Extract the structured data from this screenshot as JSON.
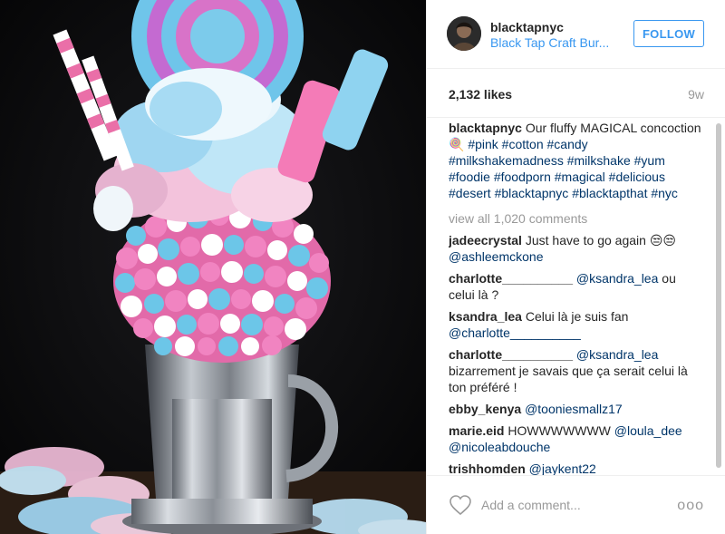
{
  "post": {
    "username": "blacktapnyc",
    "location": "Black Tap Craft Bur...",
    "follow_label": "FOLLOW",
    "likes": "2,132 likes",
    "age": "9w"
  },
  "caption": {
    "username": "blacktapnyc",
    "text": "Our fluffy MAGICAL concoction🍭",
    "hashtags": "#pink #cotton #candy #milkshakemadness #milkshake #yum #foodie #foodporn #magical #delicious #desert #blacktapnyc #blacktapthat #nyc"
  },
  "view_all_label": "view all 1,020 comments",
  "comments": [
    {
      "user": "jadeecrystal",
      "text": "Just have to go again 😒😒",
      "tag": "@ashleemckone"
    },
    {
      "user": "charlotte__________",
      "tag": "@ksandra_lea",
      "text": "ou celui là ?"
    },
    {
      "user": "ksandra_lea",
      "text": "Celui là je suis fan",
      "tag": "@charlotte__________"
    },
    {
      "user": "charlotte__________",
      "tag": "@ksandra_lea",
      "text": "bizarrement je savais que ça serait celui là ton préféré !"
    },
    {
      "user": "ebby_kenya",
      "tag": "@tooniesmallz17"
    },
    {
      "user": "marie.eid",
      "text": "HOWWWWWWW",
      "tag": "@loula_dee",
      "tag2": "@nicoleabdouche"
    },
    {
      "user": "trishhomden",
      "tag": "@jaykent22"
    }
  ],
  "add_comment_placeholder": "Add a comment...",
  "options_label": "ooo",
  "icons": {
    "like": "heart-icon",
    "options": "more-options-icon"
  },
  "colors": {
    "link_blue": "#3897f0",
    "hashtag_navy": "#003569",
    "muted_gray": "#999999",
    "text": "#262626"
  }
}
